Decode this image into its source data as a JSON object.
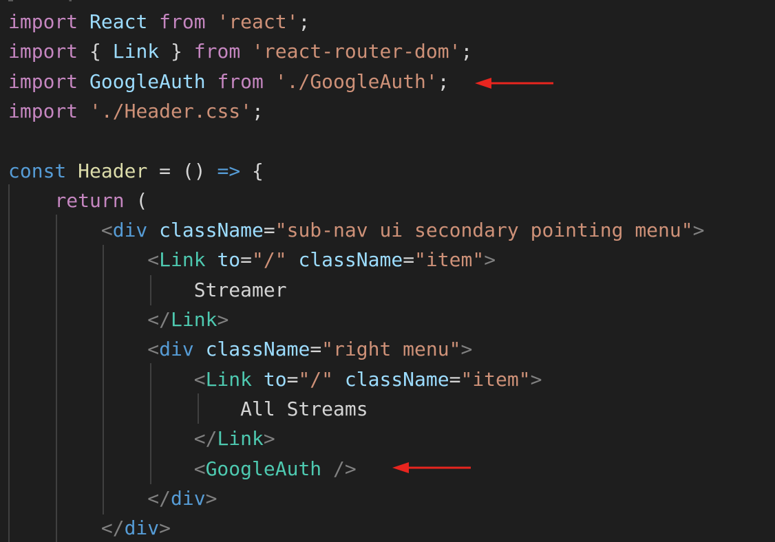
{
  "editor": {
    "background": "#1e1e1e",
    "language": "jsx",
    "colors": {
      "keyword": "#c586c0",
      "storage": "#569cd6",
      "identifier": "#9cdcfe",
      "function": "#dcdcaa",
      "string": "#ce9178",
      "component_tag": "#4ec9b0",
      "html_tag": "#569cd6",
      "bracket": "#808080",
      "arrow_annotation": "#e8251f"
    },
    "lines": [
      [
        {
          "t": "import",
          "c": "k-import"
        },
        {
          "t": " ",
          "c": "punc"
        },
        {
          "t": "React",
          "c": "ident"
        },
        {
          "t": " ",
          "c": "punc"
        },
        {
          "t": "from",
          "c": "k-import"
        },
        {
          "t": " ",
          "c": "punc"
        },
        {
          "t": "'react'",
          "c": "str"
        },
        {
          "t": ";",
          "c": "punc"
        }
      ],
      [
        {
          "t": "import",
          "c": "k-import"
        },
        {
          "t": " { ",
          "c": "punc"
        },
        {
          "t": "Link",
          "c": "ident"
        },
        {
          "t": " } ",
          "c": "punc"
        },
        {
          "t": "from",
          "c": "k-import"
        },
        {
          "t": " ",
          "c": "punc"
        },
        {
          "t": "'react-router-dom'",
          "c": "str"
        },
        {
          "t": ";",
          "c": "punc"
        }
      ],
      [
        {
          "t": "import",
          "c": "k-import"
        },
        {
          "t": " ",
          "c": "punc"
        },
        {
          "t": "GoogleAuth",
          "c": "ident"
        },
        {
          "t": " ",
          "c": "punc"
        },
        {
          "t": "from",
          "c": "k-import"
        },
        {
          "t": " ",
          "c": "punc"
        },
        {
          "t": "'./GoogleAuth'",
          "c": "str"
        },
        {
          "t": ";",
          "c": "punc"
        }
      ],
      [
        {
          "t": "import",
          "c": "k-import"
        },
        {
          "t": " ",
          "c": "punc"
        },
        {
          "t": "'./Header.css'",
          "c": "str"
        },
        {
          "t": ";",
          "c": "punc"
        }
      ],
      [],
      [
        {
          "t": "const",
          "c": "k-const"
        },
        {
          "t": " ",
          "c": "punc"
        },
        {
          "t": "Header",
          "c": "func"
        },
        {
          "t": " = () ",
          "c": "punc"
        },
        {
          "t": "=>",
          "c": "k-const"
        },
        {
          "t": " {",
          "c": "punc"
        }
      ],
      [
        {
          "t": "    ",
          "c": "punc"
        },
        {
          "t": "return",
          "c": "k-import"
        },
        {
          "t": " (",
          "c": "punc"
        }
      ],
      [
        {
          "t": "        ",
          "c": "punc"
        },
        {
          "t": "<",
          "c": "bracket"
        },
        {
          "t": "div",
          "c": "html-tag"
        },
        {
          "t": " ",
          "c": "punc"
        },
        {
          "t": "className",
          "c": "attr"
        },
        {
          "t": "=",
          "c": "punc"
        },
        {
          "t": "\"sub-nav ui secondary pointing menu\"",
          "c": "str"
        },
        {
          "t": ">",
          "c": "bracket"
        }
      ],
      [
        {
          "t": "            ",
          "c": "punc"
        },
        {
          "t": "<",
          "c": "bracket"
        },
        {
          "t": "Link",
          "c": "tag"
        },
        {
          "t": " ",
          "c": "punc"
        },
        {
          "t": "to",
          "c": "attr"
        },
        {
          "t": "=",
          "c": "punc"
        },
        {
          "t": "\"/\"",
          "c": "str"
        },
        {
          "t": " ",
          "c": "punc"
        },
        {
          "t": "className",
          "c": "attr"
        },
        {
          "t": "=",
          "c": "punc"
        },
        {
          "t": "\"item\"",
          "c": "str"
        },
        {
          "t": ">",
          "c": "bracket"
        }
      ],
      [
        {
          "t": "                ",
          "c": "punc"
        },
        {
          "t": "Streamer",
          "c": "text"
        }
      ],
      [
        {
          "t": "            ",
          "c": "punc"
        },
        {
          "t": "</",
          "c": "bracket"
        },
        {
          "t": "Link",
          "c": "tag"
        },
        {
          "t": ">",
          "c": "bracket"
        }
      ],
      [
        {
          "t": "            ",
          "c": "punc"
        },
        {
          "t": "<",
          "c": "bracket"
        },
        {
          "t": "div",
          "c": "html-tag"
        },
        {
          "t": " ",
          "c": "punc"
        },
        {
          "t": "className",
          "c": "attr"
        },
        {
          "t": "=",
          "c": "punc"
        },
        {
          "t": "\"right menu\"",
          "c": "str"
        },
        {
          "t": ">",
          "c": "bracket"
        }
      ],
      [
        {
          "t": "                ",
          "c": "punc"
        },
        {
          "t": "<",
          "c": "bracket"
        },
        {
          "t": "Link",
          "c": "tag"
        },
        {
          "t": " ",
          "c": "punc"
        },
        {
          "t": "to",
          "c": "attr"
        },
        {
          "t": "=",
          "c": "punc"
        },
        {
          "t": "\"/\"",
          "c": "str"
        },
        {
          "t": " ",
          "c": "punc"
        },
        {
          "t": "className",
          "c": "attr"
        },
        {
          "t": "=",
          "c": "punc"
        },
        {
          "t": "\"item\"",
          "c": "str"
        },
        {
          "t": ">",
          "c": "bracket"
        }
      ],
      [
        {
          "t": "                    ",
          "c": "punc"
        },
        {
          "t": "All Streams",
          "c": "text"
        }
      ],
      [
        {
          "t": "                ",
          "c": "punc"
        },
        {
          "t": "</",
          "c": "bracket"
        },
        {
          "t": "Link",
          "c": "tag"
        },
        {
          "t": ">",
          "c": "bracket"
        }
      ],
      [
        {
          "t": "                ",
          "c": "punc"
        },
        {
          "t": "<",
          "c": "bracket"
        },
        {
          "t": "GoogleAuth",
          "c": "tag"
        },
        {
          "t": " ",
          "c": "punc"
        },
        {
          "t": "/>",
          "c": "bracket"
        }
      ],
      [
        {
          "t": "            ",
          "c": "punc"
        },
        {
          "t": "</",
          "c": "bracket"
        },
        {
          "t": "div",
          "c": "html-tag"
        },
        {
          "t": ">",
          "c": "bracket"
        }
      ],
      [
        {
          "t": "        ",
          "c": "punc"
        },
        {
          "t": "</",
          "c": "bracket"
        },
        {
          "t": "div",
          "c": "html-tag"
        },
        {
          "t": ">",
          "c": "bracket"
        }
      ]
    ]
  }
}
